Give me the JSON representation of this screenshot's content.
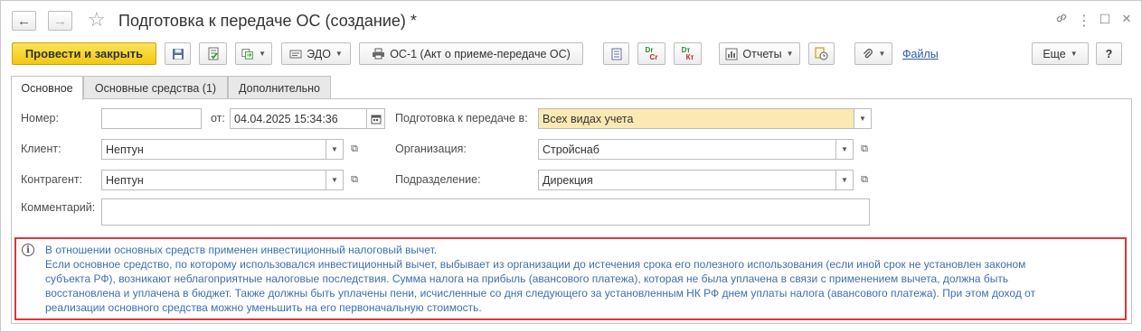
{
  "window": {
    "title": "Подготовка к передаче ОС (создание) *",
    "back_glyph": "←",
    "forward_glyph": "→",
    "favorite_glyph": "☆",
    "link_glyph": "🔗",
    "menu_glyph": "⋮",
    "maximize_glyph": "☐",
    "close_glyph": "✕"
  },
  "toolbar": {
    "post_close_label": "Провести и закрыть",
    "edo_label": "ЭДО",
    "os1_label": "ОС-1 (Акт о приеме-передаче ОС)",
    "dt_label": "Dт",
    "ct_label": "Кт",
    "dr_label": "Dr",
    "cr_label": "Cr",
    "reports_label": "Отчеты",
    "files_label": "Файлы",
    "more_label": "Еще",
    "help_label": "?"
  },
  "tabs": [
    {
      "label": "Основное"
    },
    {
      "label": "Основные средства (1)"
    },
    {
      "label": "Дополнительно"
    }
  ],
  "form": {
    "number_label": "Номер:",
    "number_value": "",
    "date_label": "от:",
    "date_value": "04.04.2025 15:34:36",
    "prep_label": "Подготовка к передаче в:",
    "prep_value": "Всех видах учета",
    "client_label": "Клиент:",
    "client_value": "Нептун",
    "org_label": "Организация:",
    "org_value": "Стройснаб",
    "contractor_label": "Контрагент:",
    "contractor_value": "Нептун",
    "dept_label": "Подразделение:",
    "dept_value": "Дирекция",
    "comment_label": "Комментарий:",
    "comment_value": ""
  },
  "info": {
    "lines": [
      "В отношении основных средств применен инвестиционный налоговый вычет.",
      "Если основное средство, по которому использовался инвестиционный вычет, выбывает из организации до истечения срока его полезного использования (если иной срок не установлен законом",
      "субъекта РФ), возникают неблагоприятные налоговые последствия. Сумма налога на прибыль (авансового платежа), которая не была уплачена в связи с применением вычета, должна быть",
      "восстановлена и уплачена в бюджет. Также должны быть уплачены пени, исчисленные со дня следующего за установленным НК РФ днем уплаты налога (авансового платежа). При этом доход от",
      "реализации основного средства можно уменьшить на его первоначальную стоимость."
    ]
  },
  "colors": {
    "primary_button": "#f2c80f",
    "highlight_field": "#fbe9b4",
    "info_border": "#e0353a",
    "info_text": "#3d6fb0",
    "link": "#2c5aa0"
  }
}
